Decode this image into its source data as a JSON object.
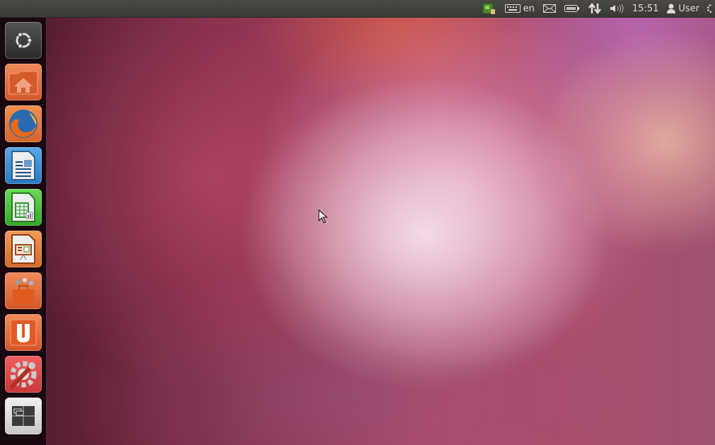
{
  "panel": {
    "keyboard_layout": "en",
    "clock": "15:51",
    "user": "User"
  },
  "launcher": {
    "items": [
      {
        "name": "dash",
        "color": "#3c3c3c"
      },
      {
        "name": "home-folder",
        "color": "#e0693a"
      },
      {
        "name": "firefox",
        "color": "#e57a3c"
      },
      {
        "name": "libreoffice-writer",
        "color": "#3a8cd0"
      },
      {
        "name": "libreoffice-calc",
        "color": "#3cbb38"
      },
      {
        "name": "libreoffice-impress",
        "color": "#d8702e"
      },
      {
        "name": "software-center",
        "color": "#e0693a"
      },
      {
        "name": "ubuntu-one",
        "color": "#e0693a"
      },
      {
        "name": "system-settings",
        "color": "#d84a4a"
      },
      {
        "name": "workspace-switcher",
        "color": "#d8d8d8"
      }
    ]
  }
}
